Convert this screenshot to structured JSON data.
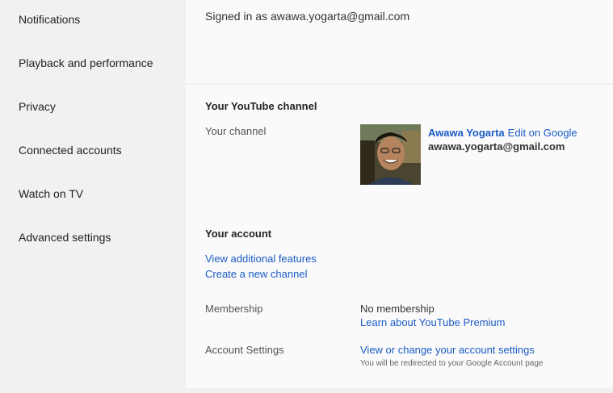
{
  "sidebar": {
    "items": [
      {
        "label": "Notifications"
      },
      {
        "label": "Playback and performance"
      },
      {
        "label": "Privacy"
      },
      {
        "label": "Connected accounts"
      },
      {
        "label": "Watch on TV"
      },
      {
        "label": "Advanced settings"
      }
    ]
  },
  "account": {
    "signed_in_text": "Signed in as awawa.yogarta@gmail.com"
  },
  "channel": {
    "heading": "Your YouTube channel",
    "label": "Your channel",
    "name": "Awawa Yogarta",
    "edit_link": "Edit on Google",
    "email": "awawa.yogarta@gmail.com"
  },
  "your_account": {
    "heading": "Your account",
    "view_features": "View additional features",
    "create_channel": "Create a new channel",
    "membership_label": "Membership",
    "membership_value": "No membership",
    "premium_link": "Learn about YouTube Premium",
    "settings_label": "Account Settings",
    "settings_link": "View or change your account settings",
    "settings_note": "You will be redirected to your Google Account page"
  }
}
